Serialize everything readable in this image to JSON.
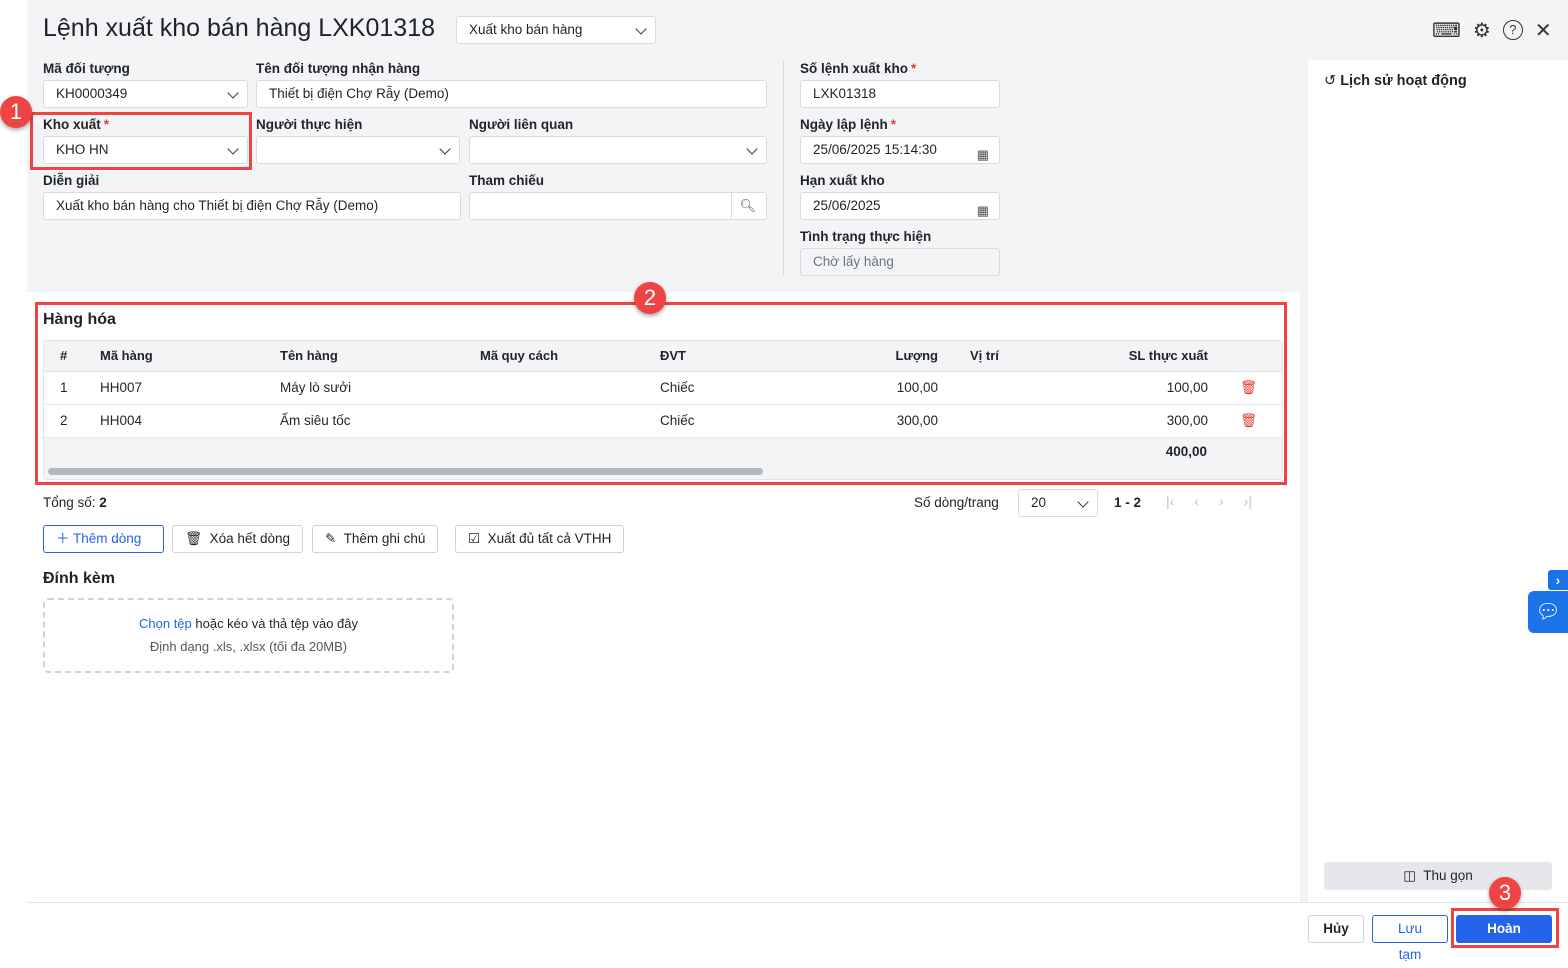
{
  "header": {
    "title": "Lệnh xuất kho bán hàng LXK01318",
    "type_select": "Xuất kho bán hàng"
  },
  "form": {
    "ma_doi_tuong": {
      "label": "Mã đối tượng",
      "value": "KH0000349"
    },
    "ten_doi_tuong": {
      "label": "Tên đối tượng nhận hàng",
      "value": "Thiết bị điện Chợ Rẫy (Demo)"
    },
    "kho_xuat": {
      "label": "Kho xuất",
      "required": "*",
      "value": "KHO HN"
    },
    "nguoi_thuc_hien": {
      "label": "Người thực hiện",
      "value": ""
    },
    "nguoi_lien_quan": {
      "label": "Người liên quan",
      "value": ""
    },
    "dien_giai": {
      "label": "Diễn giải",
      "value": "Xuất kho bán hàng cho Thiết bị điện Chợ Rẫy (Demo)"
    },
    "tham_chieu": {
      "label": "Tham chiếu",
      "value": ""
    },
    "so_lenh": {
      "label": "Số lệnh xuất kho",
      "required": "*",
      "value": "LXK01318"
    },
    "ngay_lap": {
      "label": "Ngày lập lệnh",
      "required": "*",
      "value": "25/06/2025 15:14:30"
    },
    "han_xuat": {
      "label": "Hạn xuất kho",
      "value": "25/06/2025"
    },
    "tinh_trang": {
      "label": "Tình trạng thực hiện",
      "value": "Chờ lấy hàng"
    }
  },
  "goods": {
    "title": "Hàng hóa",
    "columns": [
      "#",
      "Mã hàng",
      "Tên hàng",
      "Mã quy cách",
      "ĐVT",
      "Lượng",
      "Vị trí",
      "SL thực xuất"
    ],
    "rows": [
      {
        "no": "1",
        "code": "HH007",
        "name": "Máy lò sưởi",
        "spec": "",
        "unit": "Chiếc",
        "qty": "100,00",
        "loc": "",
        "actual": "100,00"
      },
      {
        "no": "2",
        "code": "HH004",
        "name": "Ấm siêu tốc",
        "spec": "",
        "unit": "Chiếc",
        "qty": "300,00",
        "loc": "",
        "actual": "300,00"
      }
    ],
    "total_actual": "400,00",
    "total_label": "Tổng số:",
    "total_count": "2",
    "page_size_label": "Số dòng/trang",
    "page_size": "20",
    "range": "1 - 2"
  },
  "actions": {
    "add_row": "Thêm dòng",
    "clear_rows": "Xóa hết dòng",
    "add_note": "Thêm ghi chú",
    "export_all": "Xuất đủ tất cả VTHH"
  },
  "attach": {
    "title": "Đính kèm",
    "choose": "Chọn tệp",
    "drop": " hoặc kéo và thả tệp vào đây",
    "format": "Định dạng .xls, .xlsx (tối đa 20MB)"
  },
  "history": {
    "title": "Lịch sử hoạt động",
    "collapse": "Thu gọn"
  },
  "footer": {
    "cancel": "Hủy",
    "save_draft": "Lưu tạm",
    "complete": "Hoàn thành"
  },
  "badges": [
    "1",
    "2",
    "3"
  ]
}
